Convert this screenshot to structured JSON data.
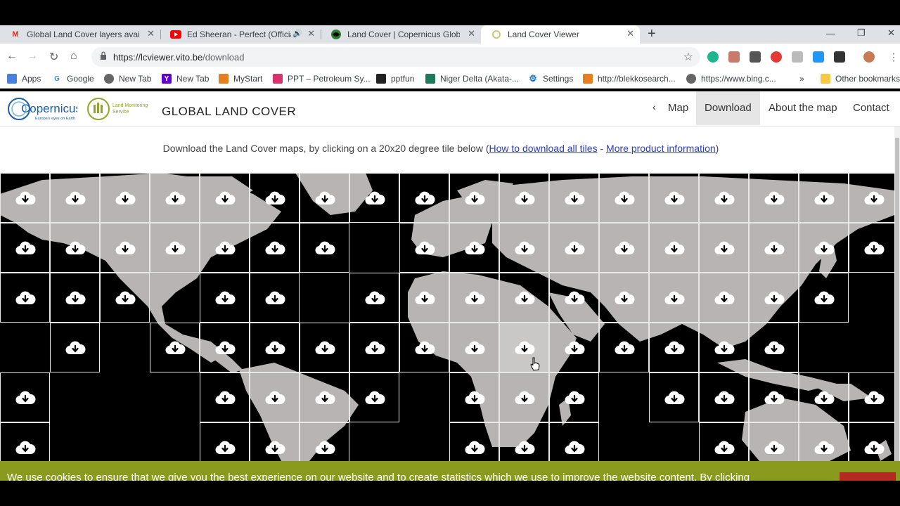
{
  "browser": {
    "tabs": [
      {
        "title": "Global Land Cover layers availabl",
        "favicon": "gmail-icon",
        "active": false
      },
      {
        "title": "Ed Sheeran - Perfect (Official",
        "favicon": "youtube-icon",
        "active": false
      },
      {
        "title": "Land Cover | Copernicus Global L",
        "favicon": "copernicus-icon",
        "active": false
      },
      {
        "title": "Land Cover Viewer",
        "favicon": "loading-icon",
        "active": true
      }
    ],
    "url_host": "https://lcviewer.vito.be",
    "url_path": "/download",
    "bookmarks": [
      {
        "label": "Apps",
        "icon": "apps-grid-icon"
      },
      {
        "label": "Google",
        "icon": "google-icon"
      },
      {
        "label": "New Tab",
        "icon": "globe-icon"
      },
      {
        "label": "New Tab",
        "icon": "yahoo-icon"
      },
      {
        "label": "MyStart",
        "icon": "mystart-icon"
      },
      {
        "label": "PPT – Petroleum Sy...",
        "icon": "ppt-icon"
      },
      {
        "label": "pptfun",
        "icon": "pptfun-icon"
      },
      {
        "label": "Niger Delta (Akata-...",
        "icon": "wave-icon"
      },
      {
        "label": "Settings",
        "icon": "gear-icon"
      },
      {
        "label": "http://blekkosearch...",
        "icon": "blekko-icon"
      },
      {
        "label": "https://www.bing.c...",
        "icon": "globe-icon"
      }
    ],
    "other_bookmarks": "Other bookmarks",
    "overflow": "»"
  },
  "site": {
    "logo_text": "Copernicus",
    "logo_tagline": "Europe's eyes on Earth",
    "lms_text_1": "Land Monitoring",
    "lms_text_2": "Service",
    "title": "GLOBAL LAND COVER",
    "nav": [
      {
        "label": "Map",
        "active": false
      },
      {
        "label": "Download",
        "active": true
      },
      {
        "label": "About the map",
        "active": false
      },
      {
        "label": "Contact",
        "active": false
      }
    ]
  },
  "instructions": {
    "prefix": "Download the Land Cover maps, by clicking on a 20x20 degree tile below (",
    "link1": "How to download all tiles",
    "sep": " - ",
    "link2": "More product information",
    "suffix": ")"
  },
  "tiles": {
    "rows": [
      [
        1,
        1,
        1,
        1,
        1,
        1,
        1,
        1,
        1,
        1,
        1,
        1,
        1,
        1,
        1,
        1,
        1,
        1
      ],
      [
        1,
        1,
        1,
        1,
        1,
        1,
        1,
        0,
        1,
        1,
        1,
        1,
        1,
        1,
        1,
        1,
        1,
        1
      ],
      [
        1,
        1,
        1,
        0,
        1,
        1,
        0,
        1,
        1,
        1,
        1,
        1,
        1,
        1,
        1,
        1,
        1,
        0
      ],
      [
        0,
        1,
        0,
        1,
        1,
        1,
        1,
        1,
        1,
        1,
        1,
        1,
        1,
        1,
        1,
        1,
        0,
        0
      ],
      [
        1,
        0,
        0,
        0,
        1,
        1,
        1,
        1,
        0,
        1,
        1,
        1,
        0,
        1,
        1,
        1,
        1,
        1
      ],
      [
        1,
        0,
        0,
        0,
        1,
        1,
        1,
        0,
        0,
        1,
        1,
        1,
        0,
        0,
        1,
        1,
        1,
        1
      ]
    ],
    "hovered": [
      3,
      10
    ]
  },
  "cookie": {
    "text": "We use cookies to ensure that we give you the best experience on our website and to create statistics which we use to improve the website content. By clicking"
  },
  "colors": {
    "land": "#b8b4b4",
    "ocean": "#000000",
    "cookie_bar": "#8a9a1e",
    "link": "#2a3cc4"
  }
}
